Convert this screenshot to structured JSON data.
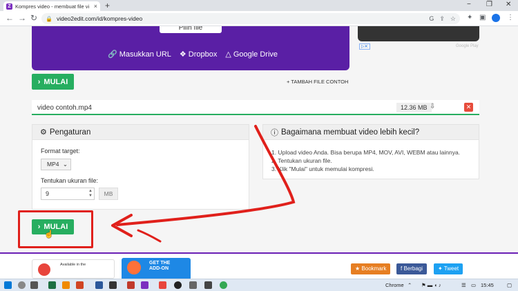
{
  "browser": {
    "tab_title": "Kompres video - membuat file vi",
    "favicon_letter": "Z",
    "url": "video2edit.com/id/kompres-video"
  },
  "upload": {
    "pick_file_label": "Pilih file",
    "sources": [
      "Masukkan URL",
      "Dropbox",
      "Google Drive"
    ]
  },
  "ad": {
    "google_label": "Google Play"
  },
  "actions": {
    "start_label": "MULAI",
    "add_sample_label": "TAMBAH FILE CONTOH"
  },
  "file": {
    "name": "video contoh.mp4",
    "size": "12.36 MB"
  },
  "settings": {
    "title": "Pengaturan",
    "format_label": "Format target:",
    "format_value": "MP4",
    "size_label": "Tentukan ukuran file:",
    "size_value": "9",
    "size_unit": "MB"
  },
  "howto": {
    "title": "Bagaimana membuat video lebih kecil?",
    "steps": [
      "1. Upload video Anda. Bisa berupa MP4, MOV, AVI, WEBM atau lainnya.",
      "2. Tentukan ukuran file.",
      "3. Klik \"Mulai\" untuk memulai kompresi."
    ]
  },
  "footer": {
    "store_text": "Available in the",
    "addon_line1": "GET THE",
    "addon_line2": "ADD-ON",
    "bookmark": "Bookmark",
    "share": "Berbagi",
    "tweet": "Tweet"
  },
  "taskbar": {
    "chrome_label": "Chrome",
    "time": "15:45"
  },
  "colors": {
    "accent_purple": "#5a1fa5",
    "button_green": "#27ae60",
    "annotation_red": "#e0201b"
  }
}
